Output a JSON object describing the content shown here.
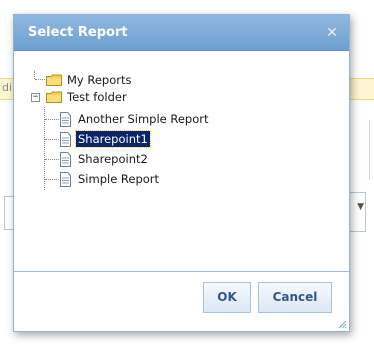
{
  "background": {
    "partial_text": "di"
  },
  "dialog": {
    "title": "Select Report",
    "close_icon": "close-icon",
    "tree": {
      "nodes": [
        {
          "label": "My Reports",
          "icon": "folder-icon",
          "level": 1
        },
        {
          "label": "Test folder",
          "icon": "folder-icon",
          "level": 1,
          "expander": "−",
          "expanded": true
        },
        {
          "label": "Another Simple Report",
          "icon": "report-icon",
          "level": 2
        },
        {
          "label": "Sharepoint1",
          "icon": "report-icon",
          "level": 2,
          "selected": true
        },
        {
          "label": "Sharepoint2",
          "icon": "report-icon",
          "level": 2
        },
        {
          "label": "Simple Report",
          "icon": "report-icon",
          "level": 2
        }
      ]
    },
    "buttons": {
      "ok": "OK",
      "cancel": "Cancel"
    }
  },
  "colors": {
    "titlebar": "#7aa9d8",
    "selection": "#0a246a",
    "button_text": "#34558a"
  }
}
